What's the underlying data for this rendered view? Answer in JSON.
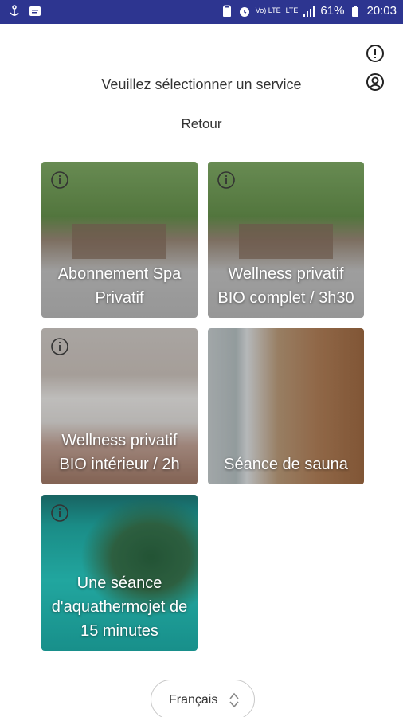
{
  "status_bar": {
    "battery": "61%",
    "time": "20:03",
    "volte_label": "Vo)\nLTE",
    "lte_label": "LTE"
  },
  "header": {
    "title": "Veuillez sélectionner un service",
    "back_label": "Retour"
  },
  "services": [
    {
      "label": "Abonnement Spa Privatif",
      "has_info": true
    },
    {
      "label": "Wellness privatif BIO complet / 3h30",
      "has_info": true
    },
    {
      "label": "Wellness privatif BIO intérieur / 2h",
      "has_info": true
    },
    {
      "label": "Séance de sauna",
      "has_info": false
    },
    {
      "label": "Une séance d'aquathermojet de 15 minutes",
      "has_info": true
    }
  ],
  "language": {
    "selected": "Français"
  },
  "colors": {
    "status_bar": "#2d3590",
    "text": "#333333",
    "tile_text": "#ffffff"
  }
}
